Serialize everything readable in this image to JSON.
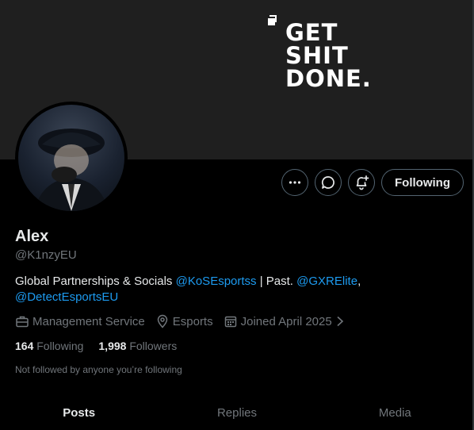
{
  "banner": {
    "slogan_lines": [
      "GET",
      "SHIT",
      "DONE."
    ]
  },
  "profile": {
    "name": "Alex",
    "handle": "@K1nzyEU",
    "bio": {
      "part1": "Global Partnerships & Socials ",
      "mention1": "@KoSEsportss",
      "part2": " | Past. ",
      "mention2": "@GXRElite",
      "part3": ",",
      "mention3": "@DetectEsportsEU"
    },
    "meta": {
      "category": "Management Service",
      "location": "Esports",
      "joined": "Joined April 2025"
    },
    "following_count": "164",
    "following_label": "Following",
    "followers_count": "1,998",
    "followers_label": "Followers",
    "not_followed_text": "Not followed by anyone you’re following"
  },
  "actions": {
    "more_icon": "more-icon",
    "message_icon": "message-icon",
    "notify_icon": "notification-bell-icon",
    "follow_label": "Following"
  },
  "tabs": [
    {
      "label": "Posts",
      "active": true
    },
    {
      "label": "Replies",
      "active": false
    },
    {
      "label": "Media",
      "active": false
    }
  ],
  "colors": {
    "accent": "#1d9bf0",
    "muted": "#71767b",
    "text": "#e7e9ea",
    "border": "#536471"
  }
}
